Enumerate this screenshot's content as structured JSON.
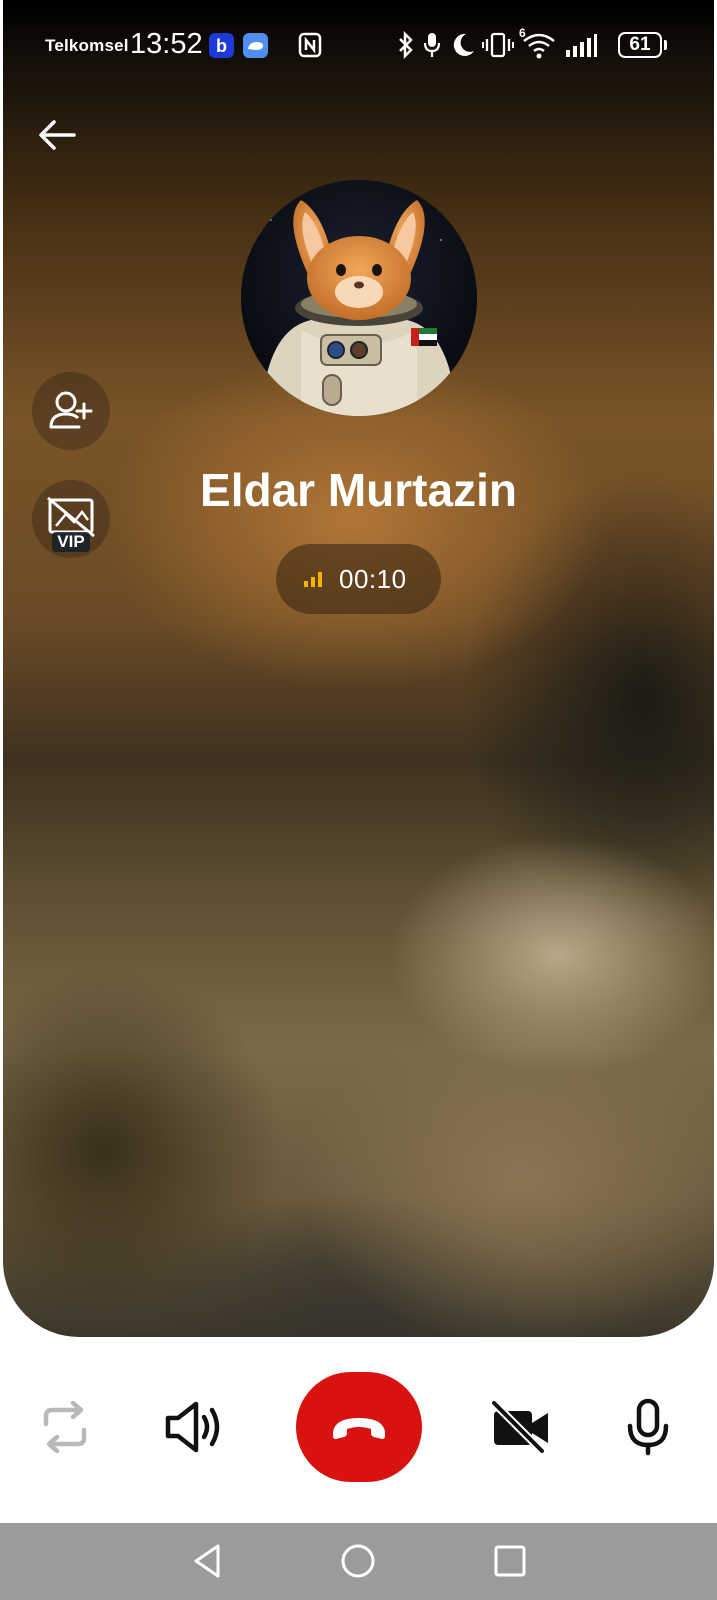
{
  "status_bar": {
    "carrier": "Telkomsel",
    "time": "13:52",
    "battery": "61",
    "network_label": "6",
    "icons": [
      "app-b-icon",
      "app-cloud-icon",
      "nfc-icon",
      "bluetooth-icon",
      "microphone-icon",
      "moon-icon",
      "vibrate-icon",
      "wifi-icon",
      "signal-icon",
      "battery-icon"
    ]
  },
  "caller": {
    "name": "Eldar Murtazin",
    "duration": "00:10",
    "signal_icon": "signal-bars-icon",
    "avatar": "astronaut-rabbit-avatar"
  },
  "side_actions": {
    "add_contact_icon": "add-person-icon",
    "vip_label": "VIP"
  },
  "controls": {
    "switch_icon": "switch-call-icon",
    "speaker_icon": "speaker-icon",
    "end_call_icon": "end-call-icon",
    "video_icon": "video-off-icon",
    "mic_icon": "microphone-icon"
  },
  "navigation": {
    "back": "back-triangle-icon",
    "home": "home-circle-icon",
    "recents": "recents-square-icon"
  },
  "colors": {
    "end_call": "#d8120f",
    "signal": "#f5b400",
    "nav_bar": "#9b9b9b"
  }
}
